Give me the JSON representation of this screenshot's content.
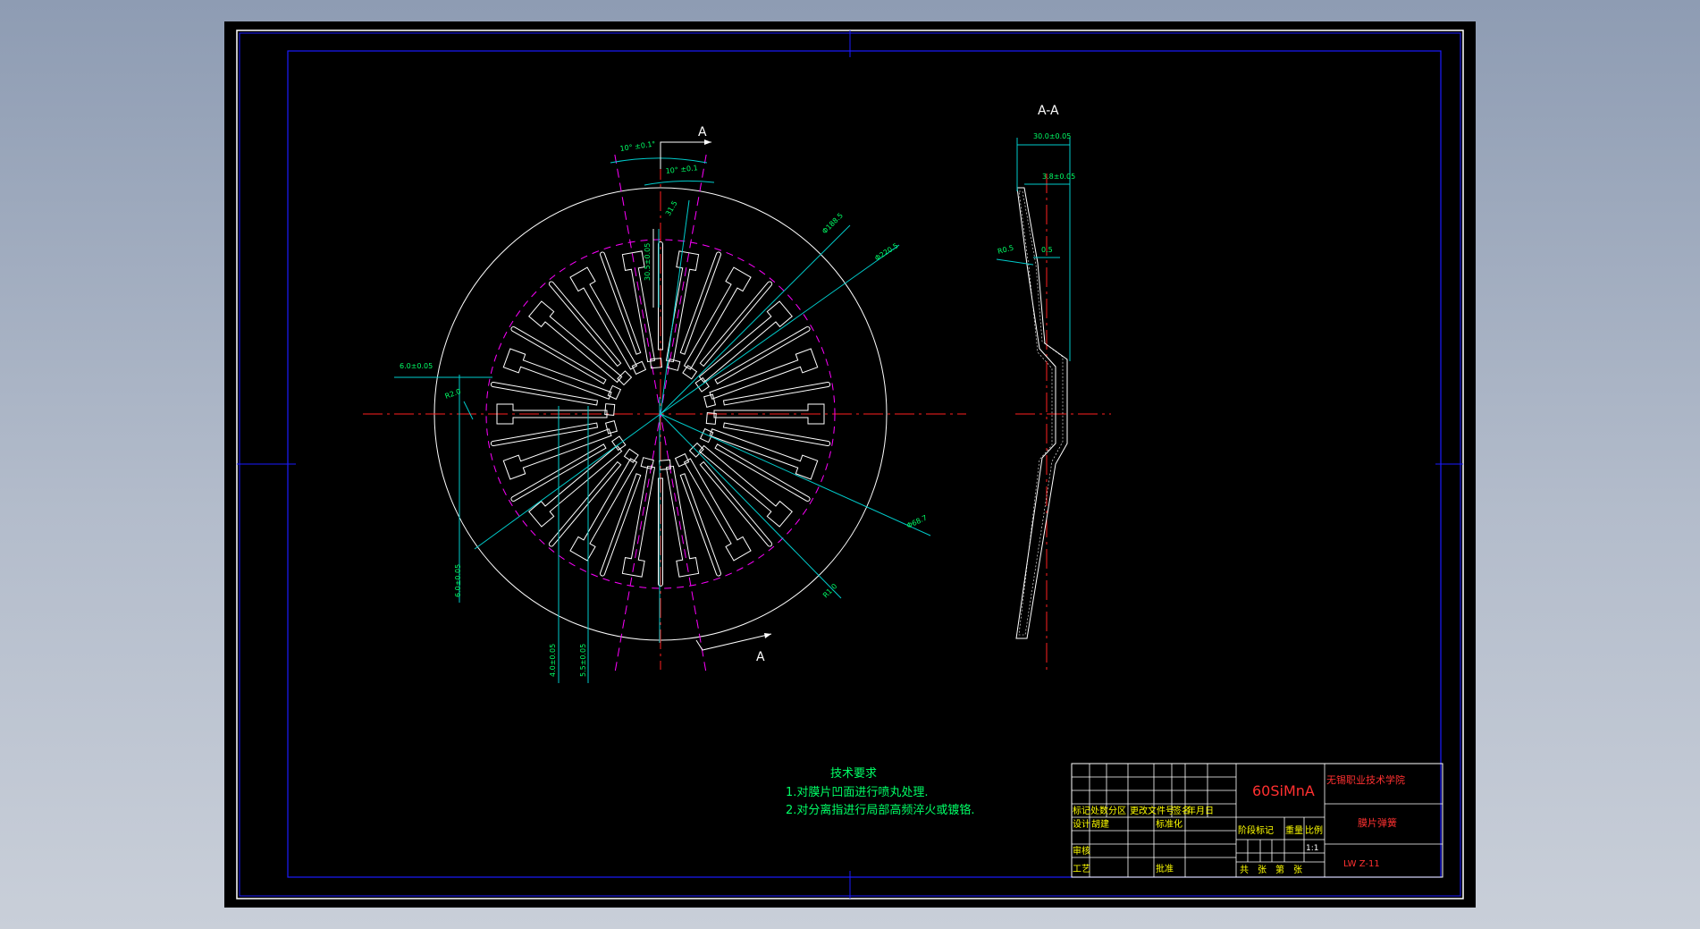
{
  "section_label": "A",
  "section_view_title": "A-A",
  "dimensions": {
    "angle_outer": "10° ±0.1°",
    "angle_inner": "10° ±0.1",
    "slot_offset": "31.5",
    "slot_length": "30.5±0.05",
    "dia_1": "Φ188.5",
    "dia_2": "Φ220.5",
    "dia_3": "Φ68.7",
    "radius_1": "R1.0",
    "thickness": "6.0±0.05",
    "r_left": "R2.0",
    "width_lower": "6.0±0.05",
    "h_1": "4.0±0.05",
    "h_2": "5.5±0.05",
    "depth_total": "30.0±0.05",
    "depth_top": "3.8±0.05",
    "rim_r": "R0.5",
    "rim_t": "0.5"
  },
  "notes": {
    "title": "技术要求",
    "items": [
      "1.对膜片凹面进行喷丸处理.",
      "2.对分离指进行局部高频淬火或镀铬."
    ]
  },
  "title_block": {
    "material": "60SiMnA",
    "school": "无锡职业技术学院",
    "part_name": "膜片弹簧",
    "drawing_no": "LW Z-11",
    "scale": "1:1",
    "row_labels": [
      "标记",
      "处数",
      "分区",
      "更改文件号",
      "签名",
      "年月日"
    ],
    "design": "设计",
    "designer": "胡建",
    "standardize": "标准化",
    "stage_mark": "阶段标记",
    "weight": "重量",
    "ratio": "比例",
    "review": "审核",
    "process": "工艺",
    "approve": "批准",
    "sheets": "共　张　第　张"
  },
  "colors": {
    "frame": "#1a1aff",
    "outline": "#ffffff",
    "centerline": "#ff2020",
    "dimension": "#00ff66",
    "leader": "#00cccc",
    "magenta": "#ff00ff",
    "yellow": "#ffff00",
    "red_text": "#ff3030"
  }
}
